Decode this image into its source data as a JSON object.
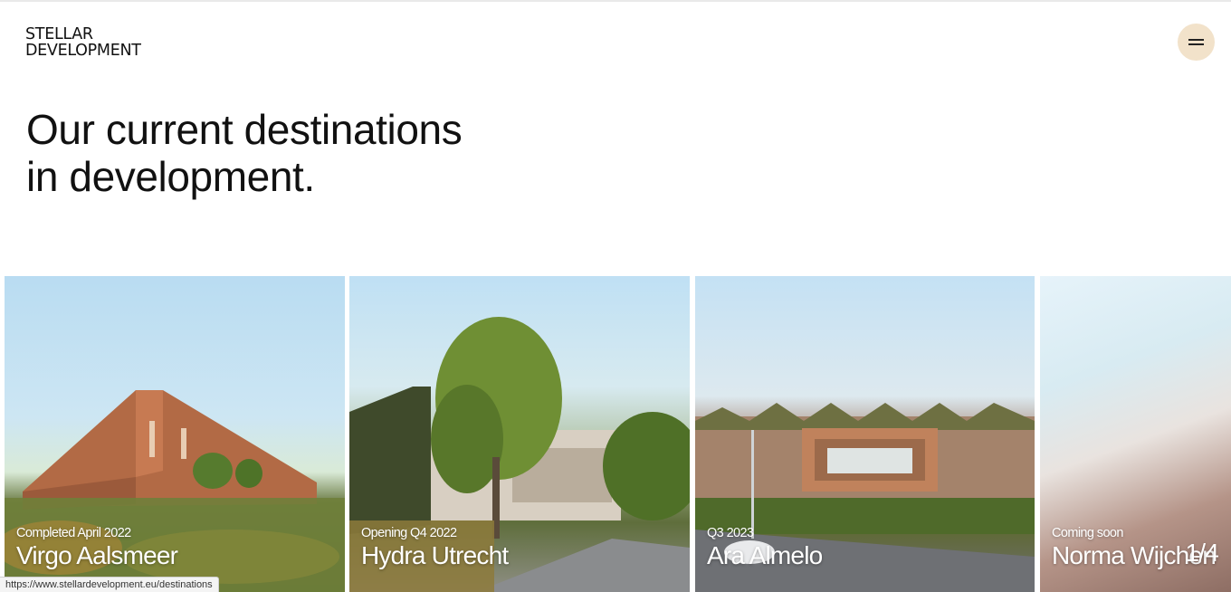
{
  "logo": {
    "line1": "STELLAR",
    "line2": "DEVELOPMENT"
  },
  "menu": {
    "icon": "hamburger-icon",
    "color": "#f2e2ca"
  },
  "headline": {
    "line1": "Our current destinations",
    "line2": "in development."
  },
  "cards": [
    {
      "status": "Completed April 2022",
      "name": "Virgo Aalsmeer"
    },
    {
      "status": "Opening Q4 2022",
      "name": "Hydra Utrecht"
    },
    {
      "status": "Q3 2023",
      "name": "Ara Almelo"
    },
    {
      "status": "Coming soon",
      "name": "Norma Wijchen"
    }
  ],
  "counter": "1/4",
  "status_url": "https://www.stellardevelopment.eu/destinations"
}
